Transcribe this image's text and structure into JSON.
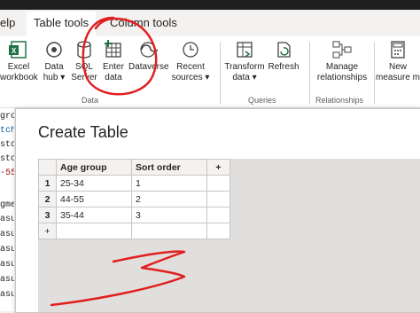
{
  "tabs": {
    "partial_help": "elp",
    "table_tools": "Table tools",
    "column_tools": "Column tools"
  },
  "ribbon": {
    "buttons": [
      {
        "line1": "Excel",
        "line2": "workbook"
      },
      {
        "line1": "Data",
        "line2": "hub ▾"
      },
      {
        "line1": "SQL",
        "line2": "Server"
      },
      {
        "line1": "Enter",
        "line2": "data"
      },
      {
        "line1": "Dataverse",
        "line2": ""
      },
      {
        "line1": "Recent",
        "line2": "sources ▾"
      },
      {
        "line1": "Transform",
        "line2": "data ▾"
      },
      {
        "line1": "Refresh",
        "line2": ""
      },
      {
        "line1": "Manage",
        "line2": "relationships"
      },
      {
        "line1": "New",
        "line2": "measure m"
      }
    ],
    "groups": {
      "data": "Data",
      "queries": "Queries",
      "relationships": "Relationships"
    }
  },
  "left_pane": [
    "gro",
    "tch",
    "stor",
    "stor",
    "-55'",
    "",
    "gme",
    "asur",
    "asur",
    "asur",
    "asur",
    "asur",
    "asur"
  ],
  "dialog": {
    "title": "Create Table",
    "columns": [
      "Age group",
      "Sort order"
    ],
    "add_column": "+",
    "rows": [
      {
        "num": "1",
        "cells": [
          "25-34",
          "1"
        ]
      },
      {
        "num": "2",
        "cells": [
          "44-55",
          "2"
        ]
      },
      {
        "num": "3",
        "cells": [
          "35-44",
          "3"
        ]
      }
    ],
    "add_row": "+"
  },
  "colors": {
    "accent_green": "#217346",
    "annotation_red": "#e02020"
  }
}
